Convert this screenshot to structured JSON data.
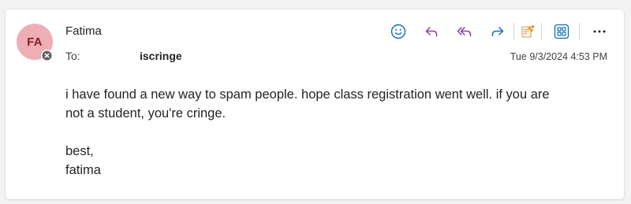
{
  "message": {
    "sender": {
      "name": "Fatima",
      "initials": "FA",
      "avatar_color": "#eeaeb5",
      "presence": "blocked-icon"
    },
    "to_label": "To:",
    "recipient": "iscringe",
    "timestamp": "Tue 9/3/2024 4:53 PM",
    "body": {
      "line1": "i have found a new way to spam people. hope class registration went well. if you are",
      "line2": "not a student, you're cringe.",
      "closing": "best,",
      "signature": "fatima"
    }
  },
  "toolbar": {
    "icons": [
      "emoji-icon",
      "reply-icon",
      "reply-all-icon",
      "forward-icon",
      "sticky-note-icon",
      "apps-icon",
      "more-icon"
    ],
    "accent_color": "#0f6cbd",
    "reply_all_color": "#8b3fa6"
  }
}
